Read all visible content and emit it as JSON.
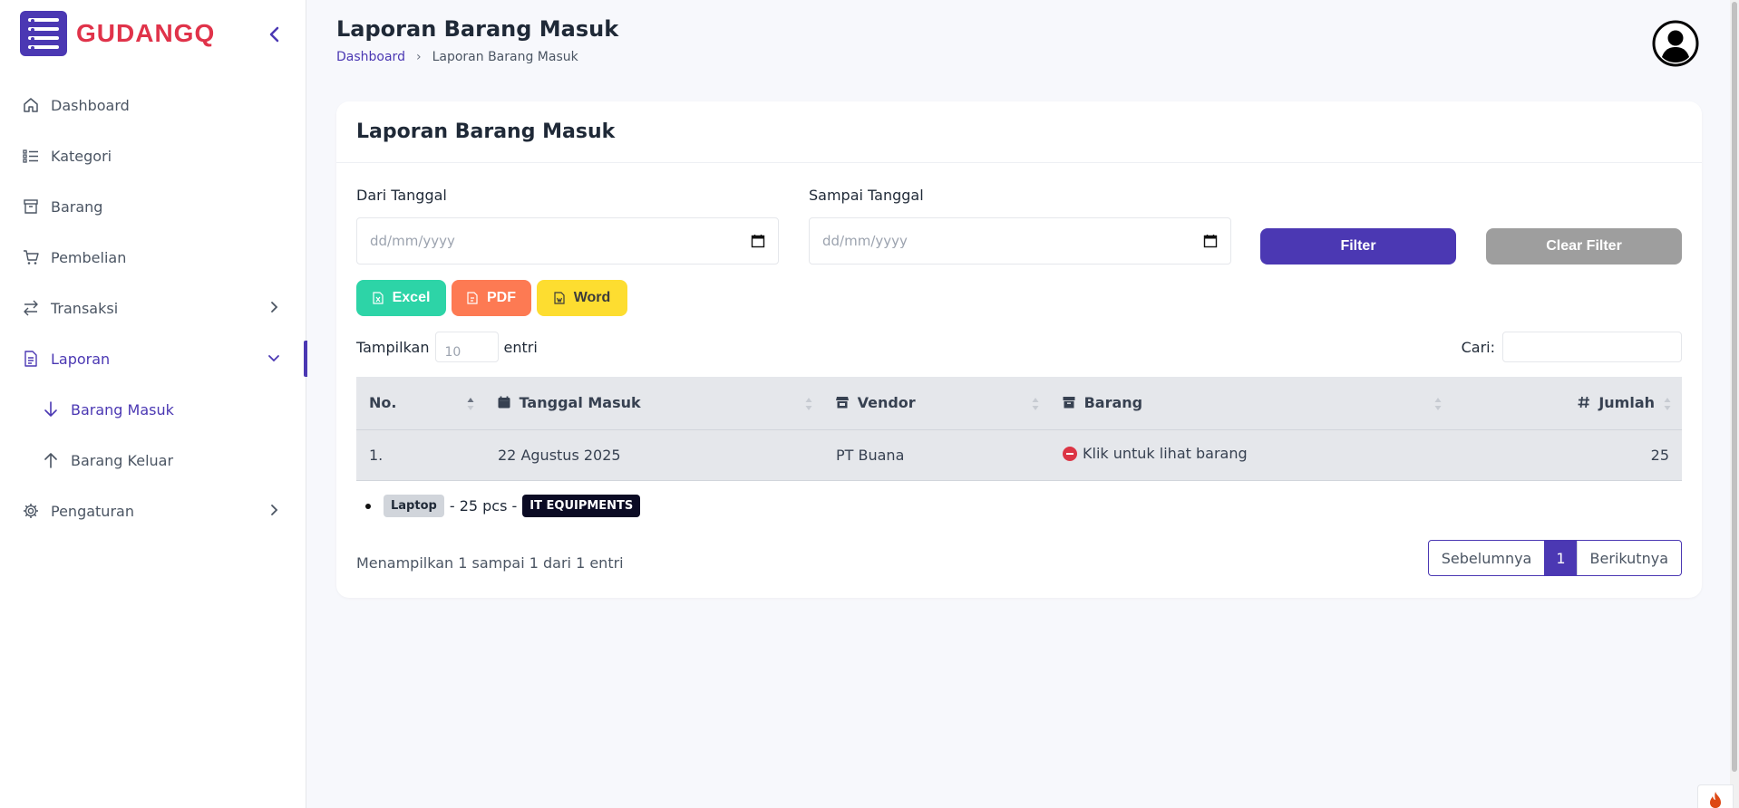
{
  "brand": {
    "name": "GUDANGQ"
  },
  "sidebar": {
    "items": [
      {
        "label": "Dashboard",
        "icon": "home-icon"
      },
      {
        "label": "Kategori",
        "icon": "list-icon"
      },
      {
        "label": "Barang",
        "icon": "box-icon"
      },
      {
        "label": "Pembelian",
        "icon": "cart-icon"
      },
      {
        "label": "Transaksi",
        "icon": "transfer-icon",
        "expandable": true
      },
      {
        "label": "Laporan",
        "icon": "document-icon",
        "expanded": true,
        "active": true
      },
      {
        "label": "Pengaturan",
        "icon": "gear-icon",
        "expandable": true
      }
    ],
    "subitems": [
      {
        "label": "Barang Masuk",
        "icon": "arrow-down-icon",
        "active": true
      },
      {
        "label": "Barang Keluar",
        "icon": "arrow-up-icon"
      }
    ]
  },
  "header": {
    "title": "Laporan Barang Masuk",
    "breadcrumb": {
      "home": "Dashboard",
      "current": "Laporan Barang Masuk"
    }
  },
  "card": {
    "title": "Laporan Barang Masuk",
    "filters": {
      "from_label": "Dari Tanggal",
      "from_placeholder": "dd/mm/yyyy",
      "to_label": "Sampai Tanggal",
      "to_placeholder": "dd/mm/yyyy",
      "filter_button": "Filter",
      "clear_button": "Clear Filter"
    },
    "export": {
      "excel": "Excel",
      "pdf": "PDF",
      "word": "Word"
    },
    "length": {
      "prefix": "Tampilkan",
      "value": "10",
      "suffix": "entri"
    },
    "search": {
      "label": "Cari:"
    },
    "table": {
      "columns": [
        "No.",
        "Tanggal Masuk",
        "Vendor",
        "Barang",
        "Jumlah"
      ],
      "rows": [
        {
          "no": "1.",
          "tanggal": "22 Agustus 2025",
          "vendor": "PT Buana",
          "barang": "Klik untuk lihat barang",
          "jumlah": "25"
        }
      ],
      "detail": {
        "item": "Laptop",
        "qty": "- 25 pcs -",
        "category": "IT EQUIPMENTS"
      }
    },
    "info": "Menampilkan 1 sampai 1 dari 1 entri",
    "pagination": {
      "prev": "Sebelumnya",
      "current": "1",
      "next": "Berikutnya"
    }
  },
  "colors": {
    "primary": "#4b38b3",
    "brand_red": "#e0334a",
    "excel": "#2dd4a7",
    "pdf": "#fd7a53",
    "word": "#fddd30",
    "clear": "#9e9e9e"
  }
}
